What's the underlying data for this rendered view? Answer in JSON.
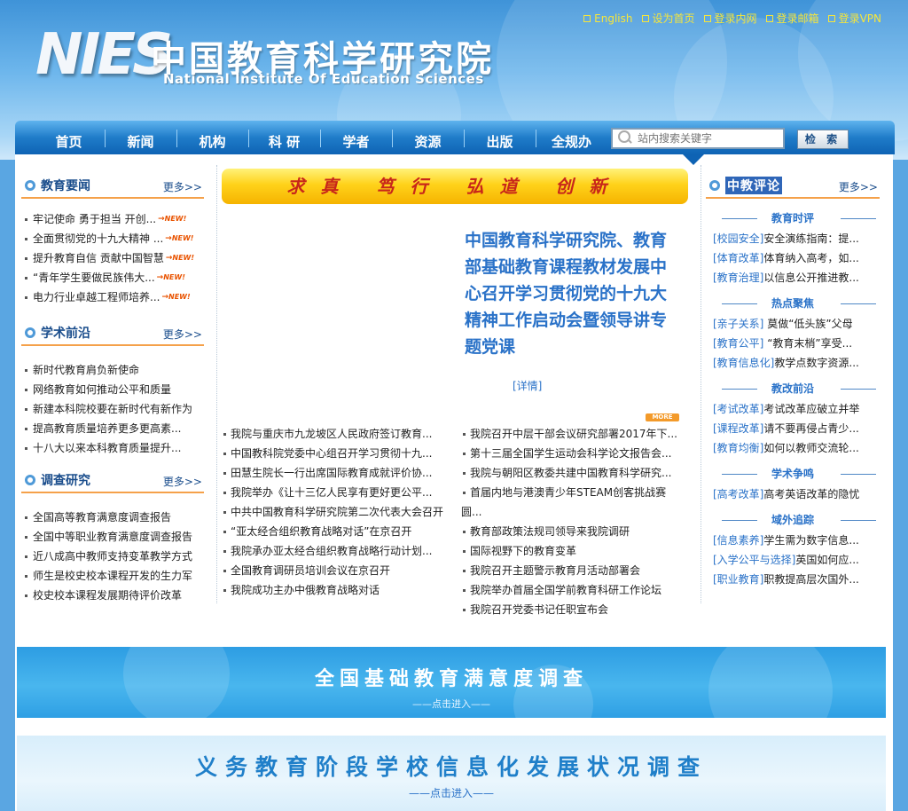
{
  "header": {
    "logo_mark": "NIES",
    "logo_cn": "中国教育科学研究院",
    "logo_en": "National Institute Of Education Sciences",
    "top_links": [
      "English",
      "设为首页",
      "登录内网",
      "登录邮箱",
      "登录VPN"
    ]
  },
  "nav": {
    "items": [
      "首页",
      "新闻",
      "机构",
      "科 研",
      "学者",
      "资源",
      "出版",
      "全规办"
    ],
    "search_placeholder": "站内搜索关键字",
    "search_button": "检 索"
  },
  "left": {
    "sections": [
      {
        "title": "教育要闻",
        "more": "更多>>",
        "items": [
          {
            "text": "牢记使命 勇于担当 开创...",
            "new": "NEW!"
          },
          {
            "text": "全面贯彻党的十九大精神 ...",
            "new": "NEW!"
          },
          {
            "text": "提升教育自信 贡献中国智慧",
            "new": "NEW!"
          },
          {
            "text": "“青年学生要做民族伟大...",
            "new": "NEW!"
          },
          {
            "text": "电力行业卓越工程师培养...",
            "new": "NEW!"
          }
        ]
      },
      {
        "title": "学术前沿",
        "more": "更多>>",
        "items": [
          {
            "text": "新时代教育肩负新使命"
          },
          {
            "text": "网络教育如何推动公平和质量"
          },
          {
            "text": "新建本科院校要在新时代有新作为"
          },
          {
            "text": "提高教育质量培养更多更高素..."
          },
          {
            "text": "十八大以来本科教育质量提升..."
          }
        ]
      },
      {
        "title": "调查研究",
        "more": "更多>>",
        "items": [
          {
            "text": "全国高等教育满意度调查报告"
          },
          {
            "text": "全国中等职业教育满意度调查报告"
          },
          {
            "text": "近八成高中教师支持变革教学方式"
          },
          {
            "text": "师生是校史校本课程开发的生力军"
          },
          {
            "text": "校史校本课程发展期待评价改革"
          }
        ]
      }
    ]
  },
  "middle": {
    "slogan": "求真 笃行 弘道 创新",
    "feature_title": "中国教育科学研究院、教育部基础教育课程教材发展中心召开学习贯彻党的十九大精神工作启动会暨领导讲专题党课",
    "feature_detail": "[详情]",
    "more_badge": "MORE",
    "news_left": [
      "我院与重庆市九龙坡区人民政府签订教育...",
      "中国教科院党委中心组召开学习贯彻十九...",
      "田慧生院长一行出席国际教育成就评价协...",
      "我院举办《让十三亿人民享有更好更公平...",
      "中共中国教育科学研究院第二次代表大会召开",
      "“亚太经合组织教育战略对话”在京召开",
      "我院承办亚太经合组织教育战略行动计划...",
      "全国教育调研员培训会议在京召开",
      "我院成功主办中俄教育战略对话"
    ],
    "news_right": [
      "我院召开中层干部会议研究部署2017年下...",
      "第十三届全国学生运动会科学论文报告会...",
      "我院与朝阳区教委共建中国教育科学研究...",
      "首届内地与港澳青少年STEAM创客挑战赛",
      "圆...",
      "教育部政策法规司领导来我院调研",
      "国际视野下的教育变革",
      "我院召开主题警示教育月活动部署会",
      "我院举办首届全国学前教育科研工作论坛",
      "我院召开党委书记任职宣布会"
    ]
  },
  "right": {
    "title": "中教评论",
    "more": "更多>>",
    "groups": [
      {
        "title": "教育时评",
        "items": [
          {
            "tag": "[校园安全]",
            "text": "安全演练指南：提..."
          },
          {
            "tag": "[体育改革]",
            "text": "体育纳入高考，如..."
          },
          {
            "tag": "[教育治理]",
            "text": "以信息公开推进教..."
          }
        ]
      },
      {
        "title": "热点聚焦",
        "items": [
          {
            "tag": "[亲子关系]",
            "text": " 莫做“低头族”父母"
          },
          {
            "tag": "[教育公平]",
            "text": " “教育末梢”享受..."
          },
          {
            "tag": "[教育信息化]",
            "text": "教学点数字资源..."
          }
        ]
      },
      {
        "title": "教改前沿",
        "items": [
          {
            "tag": "[考试改革]",
            "text": "考试改革应破立并举"
          },
          {
            "tag": "[课程改革]",
            "text": "请不要再侵占青少..."
          },
          {
            "tag": "[教育均衡]",
            "text": "如何以教师交流轮..."
          }
        ]
      },
      {
        "title": "学术争鸣",
        "items": [
          {
            "tag": "[高考改革]",
            "text": "高考英语改革的隐忧"
          }
        ]
      },
      {
        "title": "域外追踪",
        "items": [
          {
            "tag": "[信息素养]",
            "text": "学生需为数字信息..."
          },
          {
            "tag": "[入学公平与选择]",
            "text": "英国如何应..."
          },
          {
            "tag": "[职业教育]",
            "text": "职教提高层次国外..."
          }
        ]
      }
    ]
  },
  "banners": {
    "survey1_title": "全国基础教育满意度调查",
    "survey1_sub": "——点击进入——",
    "survey2_title": "义务教育阶段学校信息化发展状况调查",
    "survey2_sub": "——点击进入——"
  },
  "colors": {
    "nav_blue": "#0e63b4",
    "link_blue": "#2a72c8",
    "top_link_yellow": "#f7e63a",
    "accent_orange": "#f5a14a",
    "slogan_red": "#c8261a"
  }
}
